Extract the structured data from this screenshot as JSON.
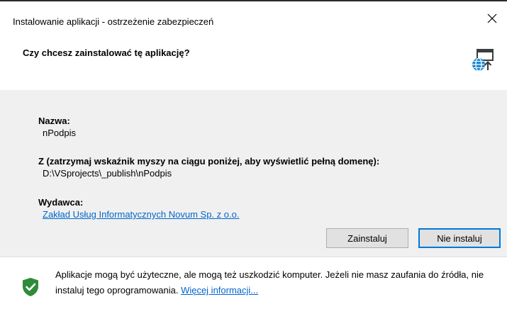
{
  "window": {
    "title": "Instalowanie aplikacji - ostrzeżenie zabezpieczeń",
    "close_glyph": "✕"
  },
  "header": {
    "question": "Czy chcesz zainstalować tę aplikację?",
    "icon": "globe-install-icon"
  },
  "details": {
    "name_label": "Nazwa:",
    "name_value": "nPodpis",
    "from_label": "Z (zatrzymaj wskaźnik myszy na ciągu poniżej, aby wyświetlić pełną domenę):",
    "from_value": "D:\\VSprojects\\_publish\\nPodpis",
    "publisher_label": "Wydawca:",
    "publisher_value": "Zakład Usług Informatycznych Novum Sp. z o.o."
  },
  "buttons": {
    "install": "Zainstaluj",
    "cancel": "Nie instaluj"
  },
  "footer": {
    "warning_text": "Aplikacje mogą być użyteczne, ale mogą też uszkodzić komputer. Jeżeli nie masz zaufania do źródła, nie instaluj tego oprogramowania. ",
    "more_info_link": "Więcej informacji...",
    "icon": "shield-check-icon"
  },
  "colors": {
    "accent": "#0078d7",
    "link": "#0066cc",
    "shield_green": "#2e8b3a",
    "panel_bg": "#f0f0f0"
  }
}
